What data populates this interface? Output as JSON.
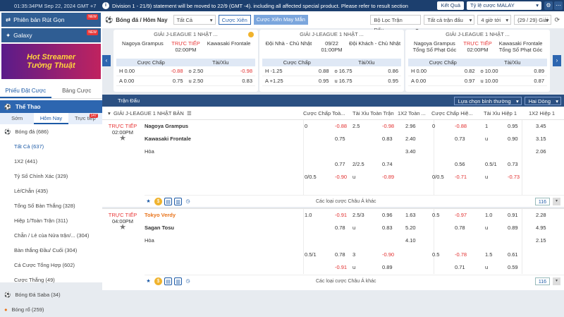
{
  "topbar": {
    "datetime": "01:35:34PM Sep 22, 2024 GMT +7",
    "ticker": "Division 1 - 21/9) statement will be moved to 22/9 (GMT -4). including all affected special product. Please refer to result section",
    "result_button": "Kết Quả",
    "odds_type": "Tỷ lệ cược MALAY"
  },
  "sidebar": {
    "banner1": "Phiên bản Rút Gọn",
    "banner2": "Galaxy",
    "hot_line1": "Hot Streamer",
    "hot_line2": "Tường Thuật",
    "tab_bets": "Phiếu Đặt Cược",
    "tab_statement": "Bảng Cược",
    "sport_header": "Thể Thao",
    "sub_tabs": [
      "Sớm",
      "Hôm Nay",
      "Trực tiếp"
    ],
    "live_count": "147",
    "items": [
      {
        "label": "Bóng đá",
        "count": "(686)"
      },
      {
        "label": "Tất Cả",
        "count": "(637)"
      },
      {
        "label": "1X2",
        "count": "(441)"
      },
      {
        "label": "Tỷ Số Chính Xác",
        "count": "(329)"
      },
      {
        "label": "Lẻ/Chẵn",
        "count": "(435)"
      },
      {
        "label": "Tổng Số Bàn Thắng",
        "count": "(328)"
      },
      {
        "label": "Hiệp 1/Toàn Trận",
        "count": "(311)"
      },
      {
        "label": "Chẵn / Lẻ của Nửa trận/...",
        "count": "(304)"
      },
      {
        "label": "Bàn thắng Đầu/ Cuối",
        "count": "(304)"
      },
      {
        "label": "Cá Cược Tổng Hợp",
        "count": "(602)"
      },
      {
        "label": "Cược Thắng",
        "count": "(49)"
      },
      {
        "label": "Bóng Đá Saba",
        "count": "(34)"
      },
      {
        "label": "Bóng rổ",
        "count": "(259)"
      }
    ]
  },
  "filter": {
    "sport": "Bóng đá / Hôm Nay",
    "league_select": "Tất Cả",
    "parlay": "Cược Xiên",
    "parlay_lucky": "Cược Xiên May Mắn",
    "match_filter": "Bộ Lọc Trận Đấu",
    "market_select": "Tất cả trận đấu",
    "time_select": "4 giờ tới",
    "count": "(29 / 29) Giải"
  },
  "cards": [
    {
      "league": "GIẢI J-LEAGUE 1 NHẬT ...",
      "home": "Nagoya Grampus",
      "live": "TRỰC TIẾP",
      "time": "02:00PM",
      "away": "Kawasaki Frontale",
      "h1": "Cược Chấp",
      "h2": "Tài/Xỉu",
      "rows": [
        [
          "H 0.00",
          "-0.88",
          "o 2.50",
          "-0.98"
        ],
        [
          "A 0.00",
          "0.75",
          "u 2.50",
          "0.83"
        ]
      ]
    },
    {
      "league": "GIẢI J-LEAGUE 1 NHẬT ...",
      "home": "Đội Nhà - Chủ Nhật",
      "live": "09/22",
      "time": "01:00PM",
      "away": "Đội Khách - Chủ Nhật",
      "h1": "Cược Chấp",
      "h2": "Tài/Xỉu",
      "rows": [
        [
          "H -1.25",
          "0.88",
          "o 16.75",
          "0.86"
        ],
        [
          "A +1.25",
          "0.95",
          "u 16.75",
          "0.95"
        ]
      ]
    },
    {
      "league": "GIẢI J-LEAGUE 1 NHẬT ...",
      "home": "Nagoya Grampus Tổng Số Phạt Góc",
      "live": "TRỰC TIẾP",
      "time": "02:00PM",
      "away": "Kawasaki Frontale Tổng Số Phạt Góc",
      "h1": "Cược Chấp",
      "h2": "Tài/Xỉu",
      "rows": [
        [
          "H 0.00",
          "0.82",
          "o 10.00",
          "0.89"
        ],
        [
          "A 0.00",
          "0.97",
          "u 10.00",
          "0.87"
        ]
      ]
    }
  ],
  "matches_header": {
    "title": "Trận Đấu",
    "sort": "Lựa chọn bình thường",
    "lines": "Hai Dòng"
  },
  "table_head": {
    "league": "GIẢI J-LEAGUE 1 NHẬT BẢN",
    "cols": [
      "Cược Chấp Toà...",
      "Tài Xỉu Toàn Trận",
      "1X2 Toàn ...",
      "Cược Chấp Hiệ...",
      "Tài Xỉu Hiệp 1",
      "1X2 Hiệp 1"
    ]
  },
  "matches": [
    {
      "live": "TRỰC TIẾP",
      "time": "02:00PM",
      "home": "Nagoya Grampus",
      "away": "Kawasaki Frontale",
      "draw": "Hòa",
      "rows": [
        [
          "0",
          "-0.88",
          "2.5",
          "-0.98",
          "2.96",
          "0",
          "-0.88",
          "1",
          "0.95",
          "3.45"
        ],
        [
          "",
          "0.75",
          "",
          "0.83",
          "2.40",
          "",
          "0.73",
          "u",
          "0.90",
          "3.15"
        ],
        [
          "",
          "",
          "",
          "",
          "3.40",
          "",
          "",
          "",
          "",
          "2.06"
        ],
        [
          "",
          "0.77",
          "2/2.5",
          "0.74",
          "",
          "",
          "0.56",
          "0.5/1",
          "0.73",
          ""
        ],
        [
          "0/0.5",
          "-0.90",
          "u",
          "-0.89",
          "",
          "0/0.5",
          "-0.71",
          "u",
          "-0.73",
          ""
        ]
      ],
      "more": "Các loại cược Châu Á khác",
      "more_count": "116"
    },
    {
      "live": "TRỰC TIẾP",
      "time": "04:00PM",
      "home": "Tokyo Verdy",
      "away": "Sagan Tosu",
      "draw": "Hòa",
      "rows": [
        [
          "1.0",
          "-0.91",
          "2.5/3",
          "0.96",
          "1.63",
          "0.5",
          "-0.97",
          "1.0",
          "0.91",
          "2.28"
        ],
        [
          "",
          "0.78",
          "u",
          "0.83",
          "5.20",
          "",
          "0.78",
          "u",
          "0.89",
          "4.95"
        ],
        [
          "",
          "",
          "",
          "",
          "4.10",
          "",
          "",
          "",
          "",
          "2.15"
        ],
        [
          "0.5/1",
          "0.78",
          "3",
          "-0.90",
          "",
          "0.5",
          "-0.78",
          "1.5",
          "0.61",
          ""
        ],
        [
          "",
          "-0.91",
          "u",
          "0.89",
          "",
          "",
          "0.71",
          "u",
          "0.59",
          ""
        ]
      ],
      "more": "Các loại cược Châu Á khác",
      "more_count": "116"
    }
  ]
}
